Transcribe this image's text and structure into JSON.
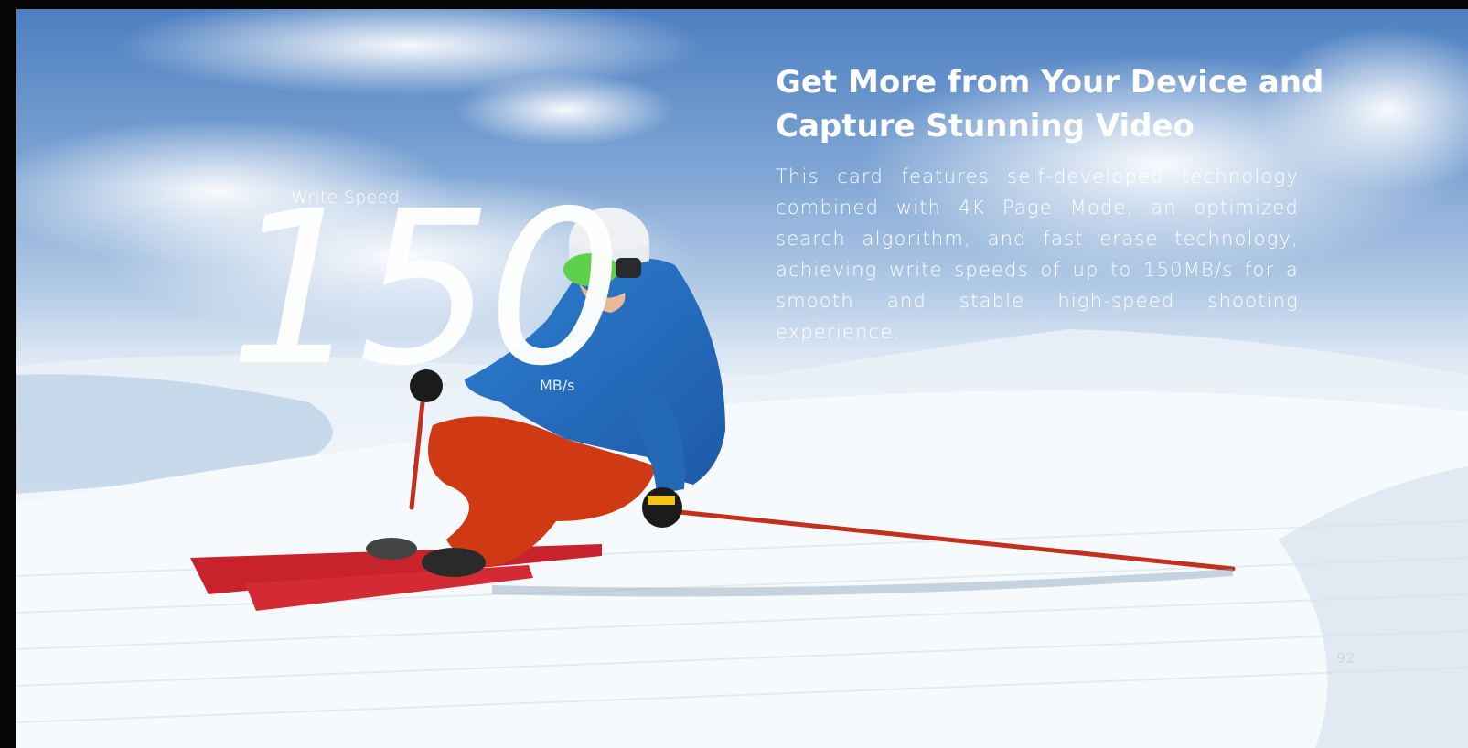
{
  "hero": {
    "write_speed_label": "Write Speed",
    "speed_value": "150",
    "speed_unit": "MB/s"
  },
  "content": {
    "heading": "Get More from Your Device and Capture Stunning Video",
    "body": "This card features self-developed technology combined with 4K Page Mode, an optimized search algorithm, and fast erase technology, achieving write speeds of up to 150MB/s for a smooth and stable high-speed shooting experience."
  },
  "page_number": "92"
}
